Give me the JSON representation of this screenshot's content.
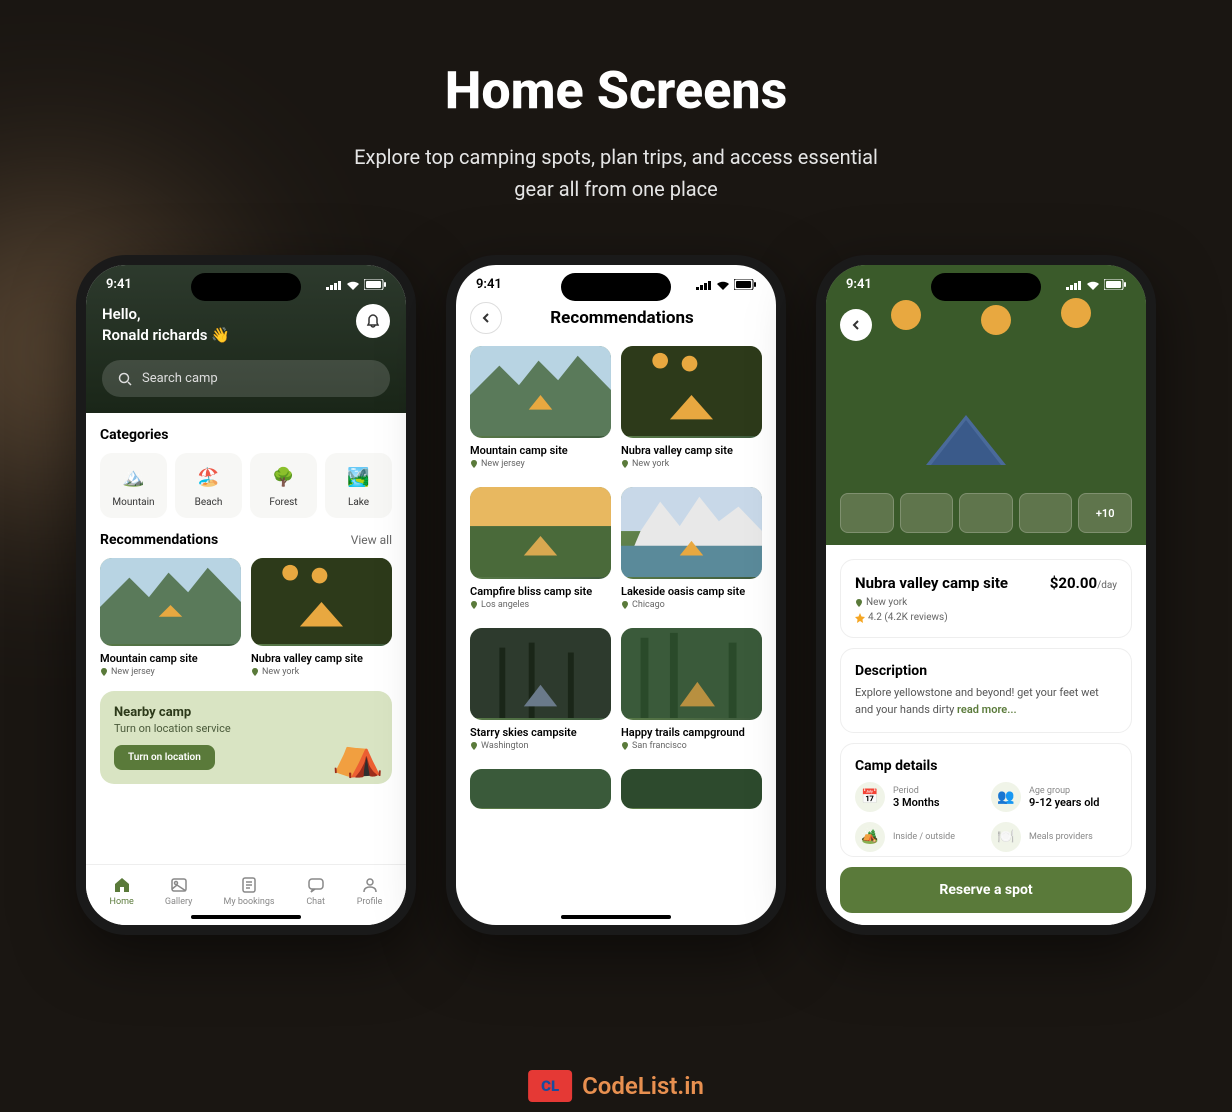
{
  "page": {
    "title": "Home Screens",
    "subtitle": "Explore top camping spots, plan trips, and access essential gear all from one place"
  },
  "status_time": "9:41",
  "phone1": {
    "greeting": "Hello,",
    "username": "Ronald richards 👋",
    "search_placeholder": "Search camp",
    "categories_label": "Categories",
    "categories": [
      {
        "label": "Mountain",
        "emoji": "🏔️"
      },
      {
        "label": "Beach",
        "emoji": "🏖️"
      },
      {
        "label": "Forest",
        "emoji": "🌳"
      },
      {
        "label": "Lake",
        "emoji": "🏞️"
      }
    ],
    "recommendations_label": "Recommendations",
    "view_all": "View all",
    "recommendations": [
      {
        "title": "Mountain camp site",
        "location": "New jersey"
      },
      {
        "title": "Nubra valley camp site",
        "location": "New york"
      }
    ],
    "nearby": {
      "title": "Nearby camp",
      "subtitle": "Turn on location service",
      "button": "Turn on location"
    },
    "nav": [
      {
        "label": "Home",
        "active": true
      },
      {
        "label": "Gallery",
        "active": false
      },
      {
        "label": "My bookings",
        "active": false
      },
      {
        "label": "Chat",
        "active": false
      },
      {
        "label": "Profile",
        "active": false
      }
    ]
  },
  "phone2": {
    "title": "Recommendations",
    "cards": [
      {
        "title": "Mountain camp site",
        "location": "New jersey"
      },
      {
        "title": "Nubra valley camp site",
        "location": "New york"
      },
      {
        "title": "Campfire bliss camp site",
        "location": "Los angeles"
      },
      {
        "title": "Lakeside oasis camp site",
        "location": "Chicago"
      },
      {
        "title": "Starry skies campsite",
        "location": "Washington"
      },
      {
        "title": "Happy trails campground",
        "location": "San francisco"
      }
    ]
  },
  "phone3": {
    "thumb_more": "+10",
    "name": "Nubra valley camp site",
    "price": "$20.00",
    "price_unit": "/day",
    "location": "New york",
    "rating": "4.2 (4.2K reviews)",
    "description_title": "Description",
    "description_text": "Explore yellowstone and beyond! get your feet wet and your hands dirty ",
    "read_more": "read more...",
    "camp_details_title": "Camp details",
    "details": [
      {
        "label": "Period",
        "value": "3 Months",
        "emoji": "📅"
      },
      {
        "label": "Age group",
        "value": "9-12 years old",
        "emoji": "👥"
      },
      {
        "label": "Inside / outside",
        "value": "",
        "emoji": "🏕️"
      },
      {
        "label": "Meals providers",
        "value": "",
        "emoji": "🍽️"
      }
    ],
    "reserve_button": "Reserve a spot"
  },
  "brand": {
    "logo_text": "CL",
    "logo_sub": "CodeList",
    "name": "CodeList.in"
  }
}
